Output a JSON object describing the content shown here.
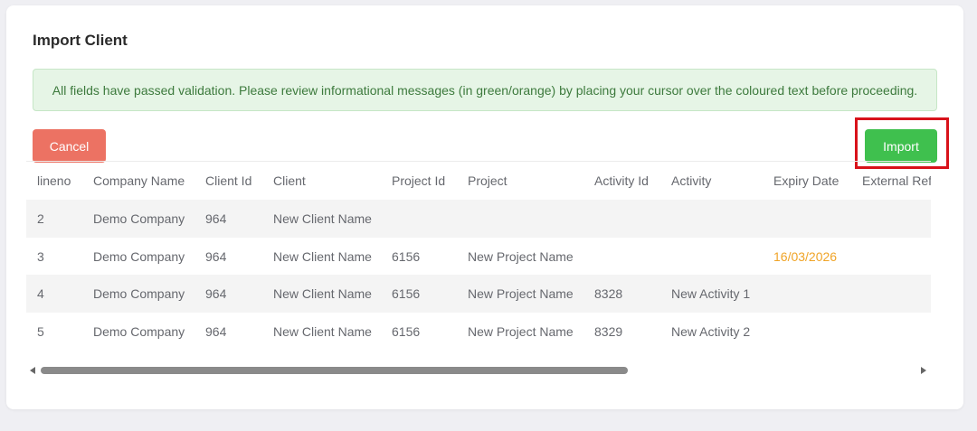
{
  "dialog": {
    "title": "Import Client",
    "alert": "All fields have passed validation. Please review informational messages (in green/orange) by placing your cursor over the coloured text before proceeding.",
    "cancel_label": "Cancel",
    "import_label": "Import"
  },
  "colors": {
    "cancel_button": "#ec7263",
    "import_button": "#3fc04e",
    "warning_text": "#f0a427",
    "highlight_box": "#d8121a"
  },
  "table": {
    "columns": [
      "lineno",
      "Company Name",
      "Client Id",
      "Client",
      "Project Id",
      "Project",
      "Activity Id",
      "Activity",
      "Expiry Date",
      "External Ref"
    ],
    "rows": [
      [
        "2",
        "Demo Company",
        "964",
        "New Client Name",
        "",
        "",
        "",
        "",
        "",
        ""
      ],
      [
        "3",
        "Demo Company",
        "964",
        "New Client Name",
        "6156",
        "New Project Name",
        "",
        "",
        "16/03/2026",
        ""
      ],
      [
        "4",
        "Demo Company",
        "964",
        "New Client Name",
        "6156",
        "New Project Name",
        "8328",
        "New Activity 1",
        "",
        ""
      ],
      [
        "5",
        "Demo Company",
        "964",
        "New Client Name",
        "6156",
        "New Project Name",
        "8329",
        "New Activity 2",
        "",
        ""
      ]
    ],
    "highlighted_cells": [
      {
        "row": 1,
        "col": 8,
        "color": "orange"
      }
    ]
  },
  "scrollbar": {
    "position_fraction": 0.0,
    "visible_fraction": 0.67
  }
}
